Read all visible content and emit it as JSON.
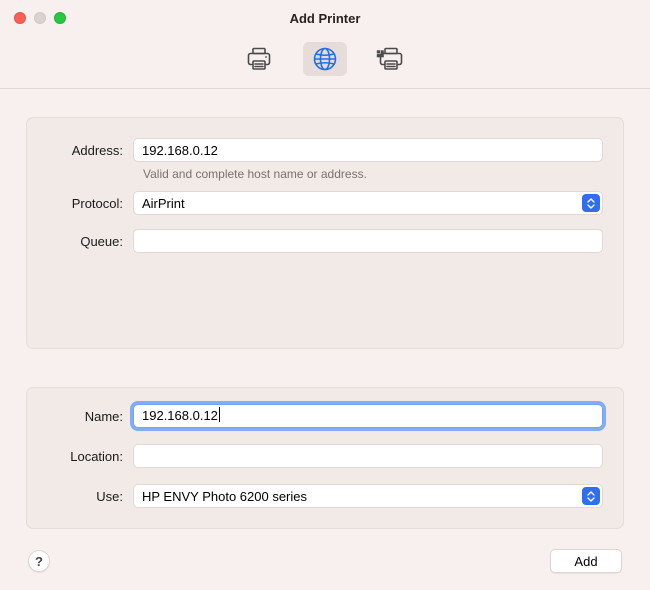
{
  "window": {
    "title": "Add Printer"
  },
  "toolbar": {
    "items": [
      {
        "name": "default-printer-icon",
        "selected": false
      },
      {
        "name": "ip-globe-icon",
        "selected": true
      },
      {
        "name": "windows-printer-icon",
        "selected": false
      }
    ]
  },
  "form_top": {
    "address": {
      "label": "Address:",
      "value": "192.168.0.12",
      "hint": "Valid and complete host name or address."
    },
    "protocol": {
      "label": "Protocol:",
      "value": "AirPrint"
    },
    "queue": {
      "label": "Queue:",
      "value": ""
    }
  },
  "form_bottom": {
    "name": {
      "label": "Name:",
      "value": "192.168.0.12"
    },
    "location": {
      "label": "Location:",
      "value": ""
    },
    "use": {
      "label": "Use:",
      "value": "HP ENVY Photo 6200 series"
    }
  },
  "footer": {
    "help": "?",
    "add_label": "Add"
  }
}
